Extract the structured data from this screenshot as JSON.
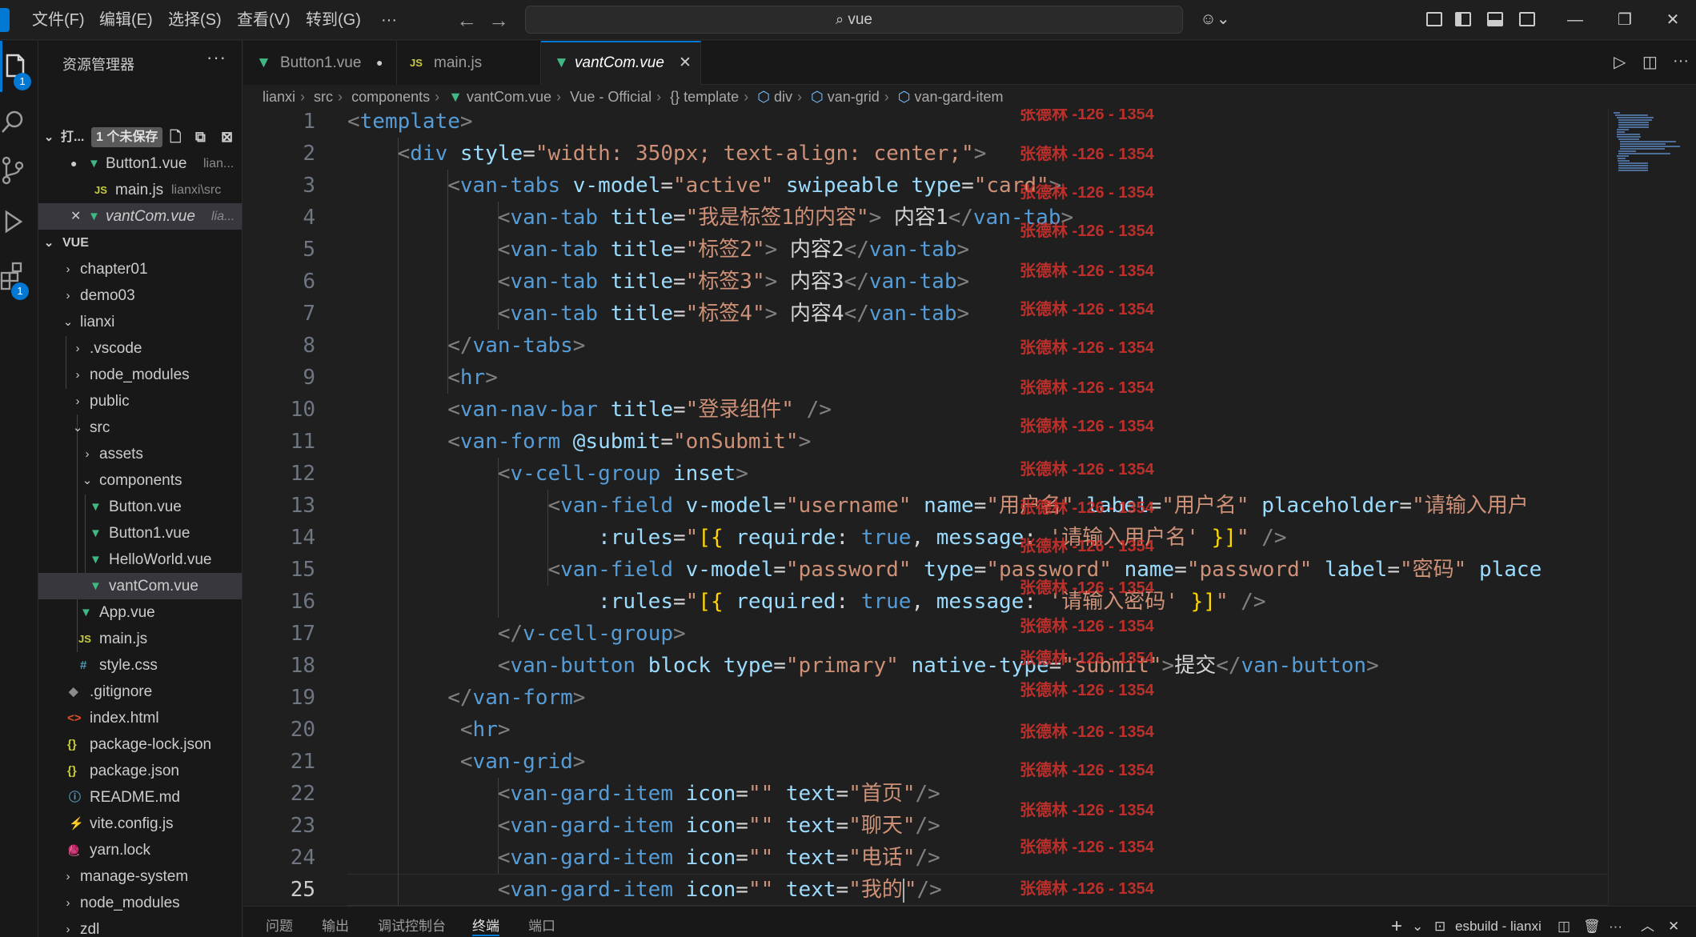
{
  "menu": [
    "文件(F)",
    "编辑(E)",
    "选择(S)",
    "查看(V)",
    "转到(G)",
    "···"
  ],
  "search": {
    "value": "vue"
  },
  "activity_badges": {
    "explorer": "1",
    "extensions": "1"
  },
  "sidebar": {
    "title": "资源管理器",
    "more": "···",
    "open_editors": {
      "header": "打...",
      "unsaved_badge": "1 个未保存",
      "items": [
        {
          "name": "Button1.vue",
          "path": "lian...",
          "modified": "●"
        },
        {
          "name": "main.js",
          "path": "lianxi\\src",
          "icon": "JS"
        },
        {
          "name": "vantCom.vue",
          "path": "lia...",
          "close": "✕"
        }
      ]
    },
    "workspace": {
      "header": "VUE",
      "tree": [
        {
          "label": "chapter01"
        },
        {
          "label": "demo03"
        },
        {
          "label": "lianxi"
        },
        {
          "label": ".vscode"
        },
        {
          "label": "node_modules"
        },
        {
          "label": "public"
        },
        {
          "label": "src"
        },
        {
          "label": "assets"
        },
        {
          "label": "components"
        },
        {
          "label": "Button.vue"
        },
        {
          "label": "Button1.vue"
        },
        {
          "label": "HelloWorld.vue"
        },
        {
          "label": "vantCom.vue"
        },
        {
          "label": "App.vue"
        },
        {
          "label": "main.js",
          "icon": "JS"
        },
        {
          "label": "style.css",
          "icon": "#"
        },
        {
          "label": ".gitignore",
          "icon": "◆"
        },
        {
          "label": "index.html",
          "icon": "<>"
        },
        {
          "label": "package-lock.json",
          "icon": "{}"
        },
        {
          "label": "package.json",
          "icon": "{}"
        },
        {
          "label": "README.md",
          "icon": "ⓘ"
        },
        {
          "label": "vite.config.js",
          "icon": "⚡"
        },
        {
          "label": "yarn.lock",
          "icon": "🧶"
        },
        {
          "label": "manage-system"
        },
        {
          "label": "node_modules"
        },
        {
          "label": "zdl"
        },
        {
          "label": "zdl01"
        }
      ]
    }
  },
  "tabs": [
    {
      "label": "Button1.vue",
      "state": "●"
    },
    {
      "label": "main.js",
      "icon": "JS"
    },
    {
      "label": "vantCom.vue",
      "state": "✕"
    }
  ],
  "breadcrumb": [
    "lianxi",
    "src",
    "components",
    "vantCom.vue",
    "Vue - Official",
    "{} template",
    "div",
    "van-grid",
    "van-gard-item"
  ],
  "editor": {
    "line_numbers": [
      "1",
      "2",
      "3",
      "4",
      "5",
      "6",
      "7",
      "8",
      "9",
      "10",
      "11",
      "12",
      "13",
      "14",
      "15",
      "16",
      "17",
      "18",
      "19",
      "20",
      "21",
      "22",
      "23",
      "24",
      "25"
    ],
    "current_line": "25",
    "watermark": "张德林 -126 - 1354",
    "lines": [
      [
        [
          "t",
          "<"
        ],
        [
          "tn",
          "template"
        ],
        [
          "t",
          ">"
        ]
      ],
      [
        [
          "t",
          "    <"
        ],
        [
          "tn",
          "div"
        ],
        [
          "an",
          " style"
        ],
        [
          "tx2",
          "="
        ],
        [
          "av",
          "\"width: 350px; text-align: center;\""
        ],
        [
          "t",
          ">"
        ]
      ],
      [
        [
          "t",
          "        <"
        ],
        [
          "tn",
          "van-tabs"
        ],
        [
          "an",
          " v-model"
        ],
        [
          "tx2",
          "="
        ],
        [
          "av",
          "\"active\""
        ],
        [
          "an",
          " swipeable"
        ],
        [
          "an",
          " type"
        ],
        [
          "tx2",
          "="
        ],
        [
          "av",
          "\"card\""
        ],
        [
          "t",
          ">"
        ]
      ],
      [
        [
          "t",
          "            <"
        ],
        [
          "tn",
          "van-tab"
        ],
        [
          "an",
          " title"
        ],
        [
          "tx2",
          "="
        ],
        [
          "av",
          "\"我是标签1的内容\""
        ],
        [
          "t",
          ">"
        ],
        [
          "tx2",
          " 内容1"
        ],
        [
          "t",
          "</"
        ],
        [
          "tn",
          "van-tab"
        ],
        [
          "t",
          ">"
        ]
      ],
      [
        [
          "t",
          "            <"
        ],
        [
          "tn",
          "van-tab"
        ],
        [
          "an",
          " title"
        ],
        [
          "tx2",
          "="
        ],
        [
          "av",
          "\"标签2\""
        ],
        [
          "t",
          ">"
        ],
        [
          "tx2",
          " 内容2"
        ],
        [
          "t",
          "</"
        ],
        [
          "tn",
          "van-tab"
        ],
        [
          "t",
          ">"
        ]
      ],
      [
        [
          "t",
          "            <"
        ],
        [
          "tn",
          "van-tab"
        ],
        [
          "an",
          " title"
        ],
        [
          "tx2",
          "="
        ],
        [
          "av",
          "\"标签3\""
        ],
        [
          "t",
          ">"
        ],
        [
          "tx2",
          " 内容3"
        ],
        [
          "t",
          "</"
        ],
        [
          "tn",
          "van-tab"
        ],
        [
          "t",
          ">"
        ]
      ],
      [
        [
          "t",
          "            <"
        ],
        [
          "tn",
          "van-tab"
        ],
        [
          "an",
          " title"
        ],
        [
          "tx2",
          "="
        ],
        [
          "av",
          "\"标签4\""
        ],
        [
          "t",
          ">"
        ],
        [
          "tx2",
          " 内容4"
        ],
        [
          "t",
          "</"
        ],
        [
          "tn",
          "van-tab"
        ],
        [
          "t",
          ">"
        ]
      ],
      [
        [
          "t",
          "        </"
        ],
        [
          "tn",
          "van-tabs"
        ],
        [
          "t",
          ">"
        ]
      ],
      [
        [
          "t",
          "        <"
        ],
        [
          "tn",
          "hr"
        ],
        [
          "t",
          ">"
        ]
      ],
      [
        [
          "t",
          "        <"
        ],
        [
          "tn",
          "van-nav-bar"
        ],
        [
          "an",
          " title"
        ],
        [
          "tx2",
          "="
        ],
        [
          "av",
          "\"登录组件\""
        ],
        [
          "t",
          " />"
        ]
      ],
      [
        [
          "t",
          "        <"
        ],
        [
          "tn",
          "van-form"
        ],
        [
          "an",
          " @submit"
        ],
        [
          "tx2",
          "="
        ],
        [
          "av",
          "\"onSubmit\""
        ],
        [
          "t",
          ">"
        ]
      ],
      [
        [
          "t",
          "            <"
        ],
        [
          "tn",
          "v-cell-group"
        ],
        [
          "an",
          " inset"
        ],
        [
          "t",
          ">"
        ]
      ],
      [
        [
          "t",
          "                <"
        ],
        [
          "tn",
          "van-field"
        ],
        [
          "an",
          " v-model"
        ],
        [
          "tx2",
          "="
        ],
        [
          "av",
          "\"username\""
        ],
        [
          "an",
          " name"
        ],
        [
          "tx2",
          "="
        ],
        [
          "av",
          "\"用户名\""
        ],
        [
          "an",
          " label"
        ],
        [
          "tx2",
          "="
        ],
        [
          "av",
          "\"用户名\""
        ],
        [
          "an",
          " placeholder"
        ],
        [
          "tx2",
          "="
        ],
        [
          "av",
          "\"请输入用户"
        ]
      ],
      [
        [
          "an",
          "                    :rules"
        ],
        [
          "tx2",
          "="
        ],
        [
          "av",
          "\""
        ],
        [
          "br",
          "[{"
        ],
        [
          "an",
          " requirde"
        ],
        [
          "tx2",
          ": "
        ],
        [
          "kw",
          "true"
        ],
        [
          "tx2",
          ", "
        ],
        [
          "an",
          "message"
        ],
        [
          "tx2",
          ": "
        ],
        [
          "av",
          "'请输入用户名'"
        ],
        [
          "br",
          " }]"
        ],
        [
          "av",
          "\""
        ],
        [
          "t",
          " />"
        ]
      ],
      [
        [
          "t",
          "                <"
        ],
        [
          "tn",
          "van-field"
        ],
        [
          "an",
          " v-model"
        ],
        [
          "tx2",
          "="
        ],
        [
          "av",
          "\"password\""
        ],
        [
          "an",
          " type"
        ],
        [
          "tx2",
          "="
        ],
        [
          "av",
          "\"password\""
        ],
        [
          "an",
          " name"
        ],
        [
          "tx2",
          "="
        ],
        [
          "av",
          "\"password\""
        ],
        [
          "an",
          " label"
        ],
        [
          "tx2",
          "="
        ],
        [
          "av",
          "\"密码\""
        ],
        [
          "an",
          " place"
        ]
      ],
      [
        [
          "an",
          "                    :rules"
        ],
        [
          "tx2",
          "="
        ],
        [
          "av",
          "\""
        ],
        [
          "br",
          "[{"
        ],
        [
          "an",
          " required"
        ],
        [
          "tx2",
          ": "
        ],
        [
          "kw",
          "true"
        ],
        [
          "tx2",
          ", "
        ],
        [
          "an",
          "message"
        ],
        [
          "tx2",
          ": "
        ],
        [
          "av",
          "'请输入密码'"
        ],
        [
          "br",
          " }]"
        ],
        [
          "av",
          "\""
        ],
        [
          "t",
          " />"
        ]
      ],
      [
        [
          "t",
          "            </"
        ],
        [
          "tn",
          "v-cell-group"
        ],
        [
          "t",
          ">"
        ]
      ],
      [
        [
          "t",
          "            <"
        ],
        [
          "tn",
          "van-button"
        ],
        [
          "an",
          " block"
        ],
        [
          "an",
          " type"
        ],
        [
          "tx2",
          "="
        ],
        [
          "av",
          "\"primary\""
        ],
        [
          "an",
          " native-type"
        ],
        [
          "tx2",
          "="
        ],
        [
          "av",
          "\"submit\""
        ],
        [
          "t",
          ">"
        ],
        [
          "tx2",
          "提交"
        ],
        [
          "t",
          "</"
        ],
        [
          "tn",
          "van-button"
        ],
        [
          "t",
          ">"
        ]
      ],
      [
        [
          "t",
          "        </"
        ],
        [
          "tn",
          "van-form"
        ],
        [
          "t",
          ">"
        ]
      ],
      [
        [
          "t",
          "         <"
        ],
        [
          "tn",
          "hr"
        ],
        [
          "t",
          ">"
        ]
      ],
      [
        [
          "t",
          "         <"
        ],
        [
          "tn",
          "van-grid"
        ],
        [
          "t",
          ">"
        ]
      ],
      [
        [
          "t",
          "            <"
        ],
        [
          "tn",
          "van-gard-item"
        ],
        [
          "an",
          " icon"
        ],
        [
          "tx2",
          "="
        ],
        [
          "av",
          "\"\""
        ],
        [
          "an",
          " text"
        ],
        [
          "tx2",
          "="
        ],
        [
          "av",
          "\"首页\""
        ],
        [
          "t",
          "/>"
        ]
      ],
      [
        [
          "t",
          "            <"
        ],
        [
          "tn",
          "van-gard-item"
        ],
        [
          "an",
          " icon"
        ],
        [
          "tx2",
          "="
        ],
        [
          "av",
          "\"\""
        ],
        [
          "an",
          " text"
        ],
        [
          "tx2",
          "="
        ],
        [
          "av",
          "\"聊天\""
        ],
        [
          "t",
          "/>"
        ]
      ],
      [
        [
          "t",
          "            <"
        ],
        [
          "tn",
          "van-gard-item"
        ],
        [
          "an",
          " icon"
        ],
        [
          "tx2",
          "="
        ],
        [
          "av",
          "\"\""
        ],
        [
          "an",
          " text"
        ],
        [
          "tx2",
          "="
        ],
        [
          "av",
          "\"电话\""
        ],
        [
          "t",
          "/>"
        ]
      ],
      [
        [
          "t",
          "            <"
        ],
        [
          "tn",
          "van-gard-item"
        ],
        [
          "an",
          " icon"
        ],
        [
          "tx2",
          "="
        ],
        [
          "av",
          "\"\""
        ],
        [
          "an",
          " text"
        ],
        [
          "tx2",
          "="
        ],
        [
          "av",
          "\"我的"
        ],
        [
          "cursor",
          ""
        ],
        [
          "av",
          "\""
        ],
        [
          "t",
          "/>"
        ]
      ]
    ]
  },
  "panel": {
    "tabs": [
      "问题",
      "输出",
      "调试控制台",
      "终端",
      "端口"
    ],
    "active_tab": "终端",
    "terminal_name": "esbuild - lianxi",
    "add": "+"
  },
  "colors": {
    "accent": "#0078d4",
    "vue": "#41b883",
    "watermark": "#d9322c"
  }
}
